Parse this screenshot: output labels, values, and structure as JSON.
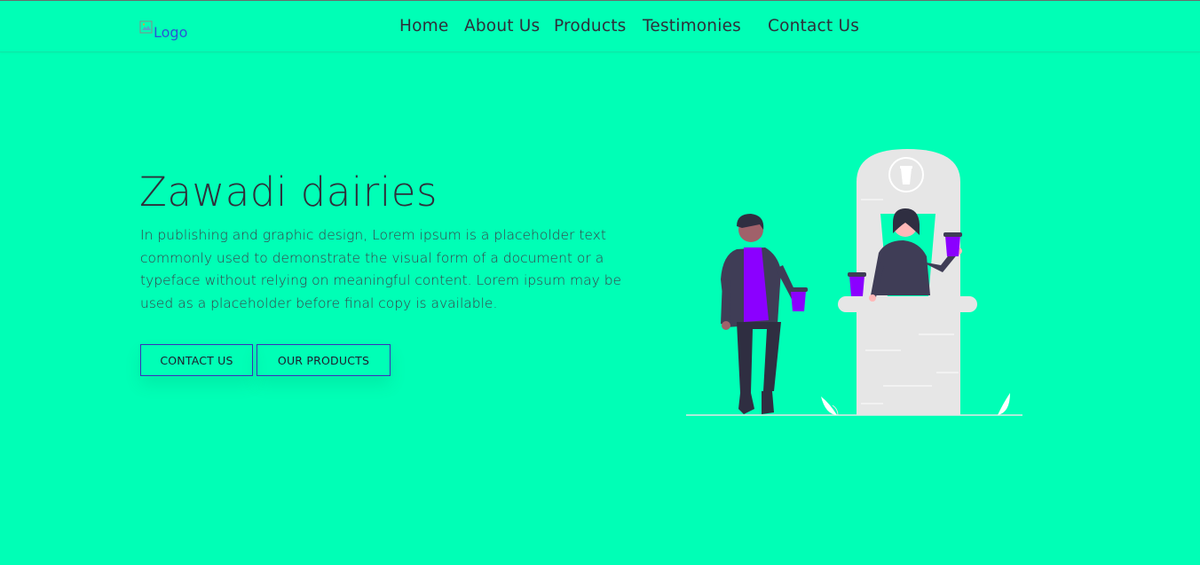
{
  "header": {
    "logo_alt": "Logo",
    "nav": [
      {
        "label": "Home"
      },
      {
        "label": "About Us"
      },
      {
        "label": "Products"
      },
      {
        "label": "Testimonies"
      },
      {
        "label": "Contact Us"
      }
    ]
  },
  "hero": {
    "title": "Zawadi dairies",
    "description": "In publishing and graphic design, Lorem ipsum is a placeholder text commonly used to demonstrate the visual form of a document or a typeface without relying on meaningful content. Lorem ipsum may be used as a placeholder before final copy is available.",
    "buttons": {
      "contact": "CONTACT US",
      "products": "OUR PRODUCTS"
    },
    "illustration": "coffee-kiosk-illustration"
  },
  "colors": {
    "background": "#00ffb6",
    "accent": "#8b00ff",
    "button_border": "#3b2dba",
    "text": "#2f2f3a"
  }
}
